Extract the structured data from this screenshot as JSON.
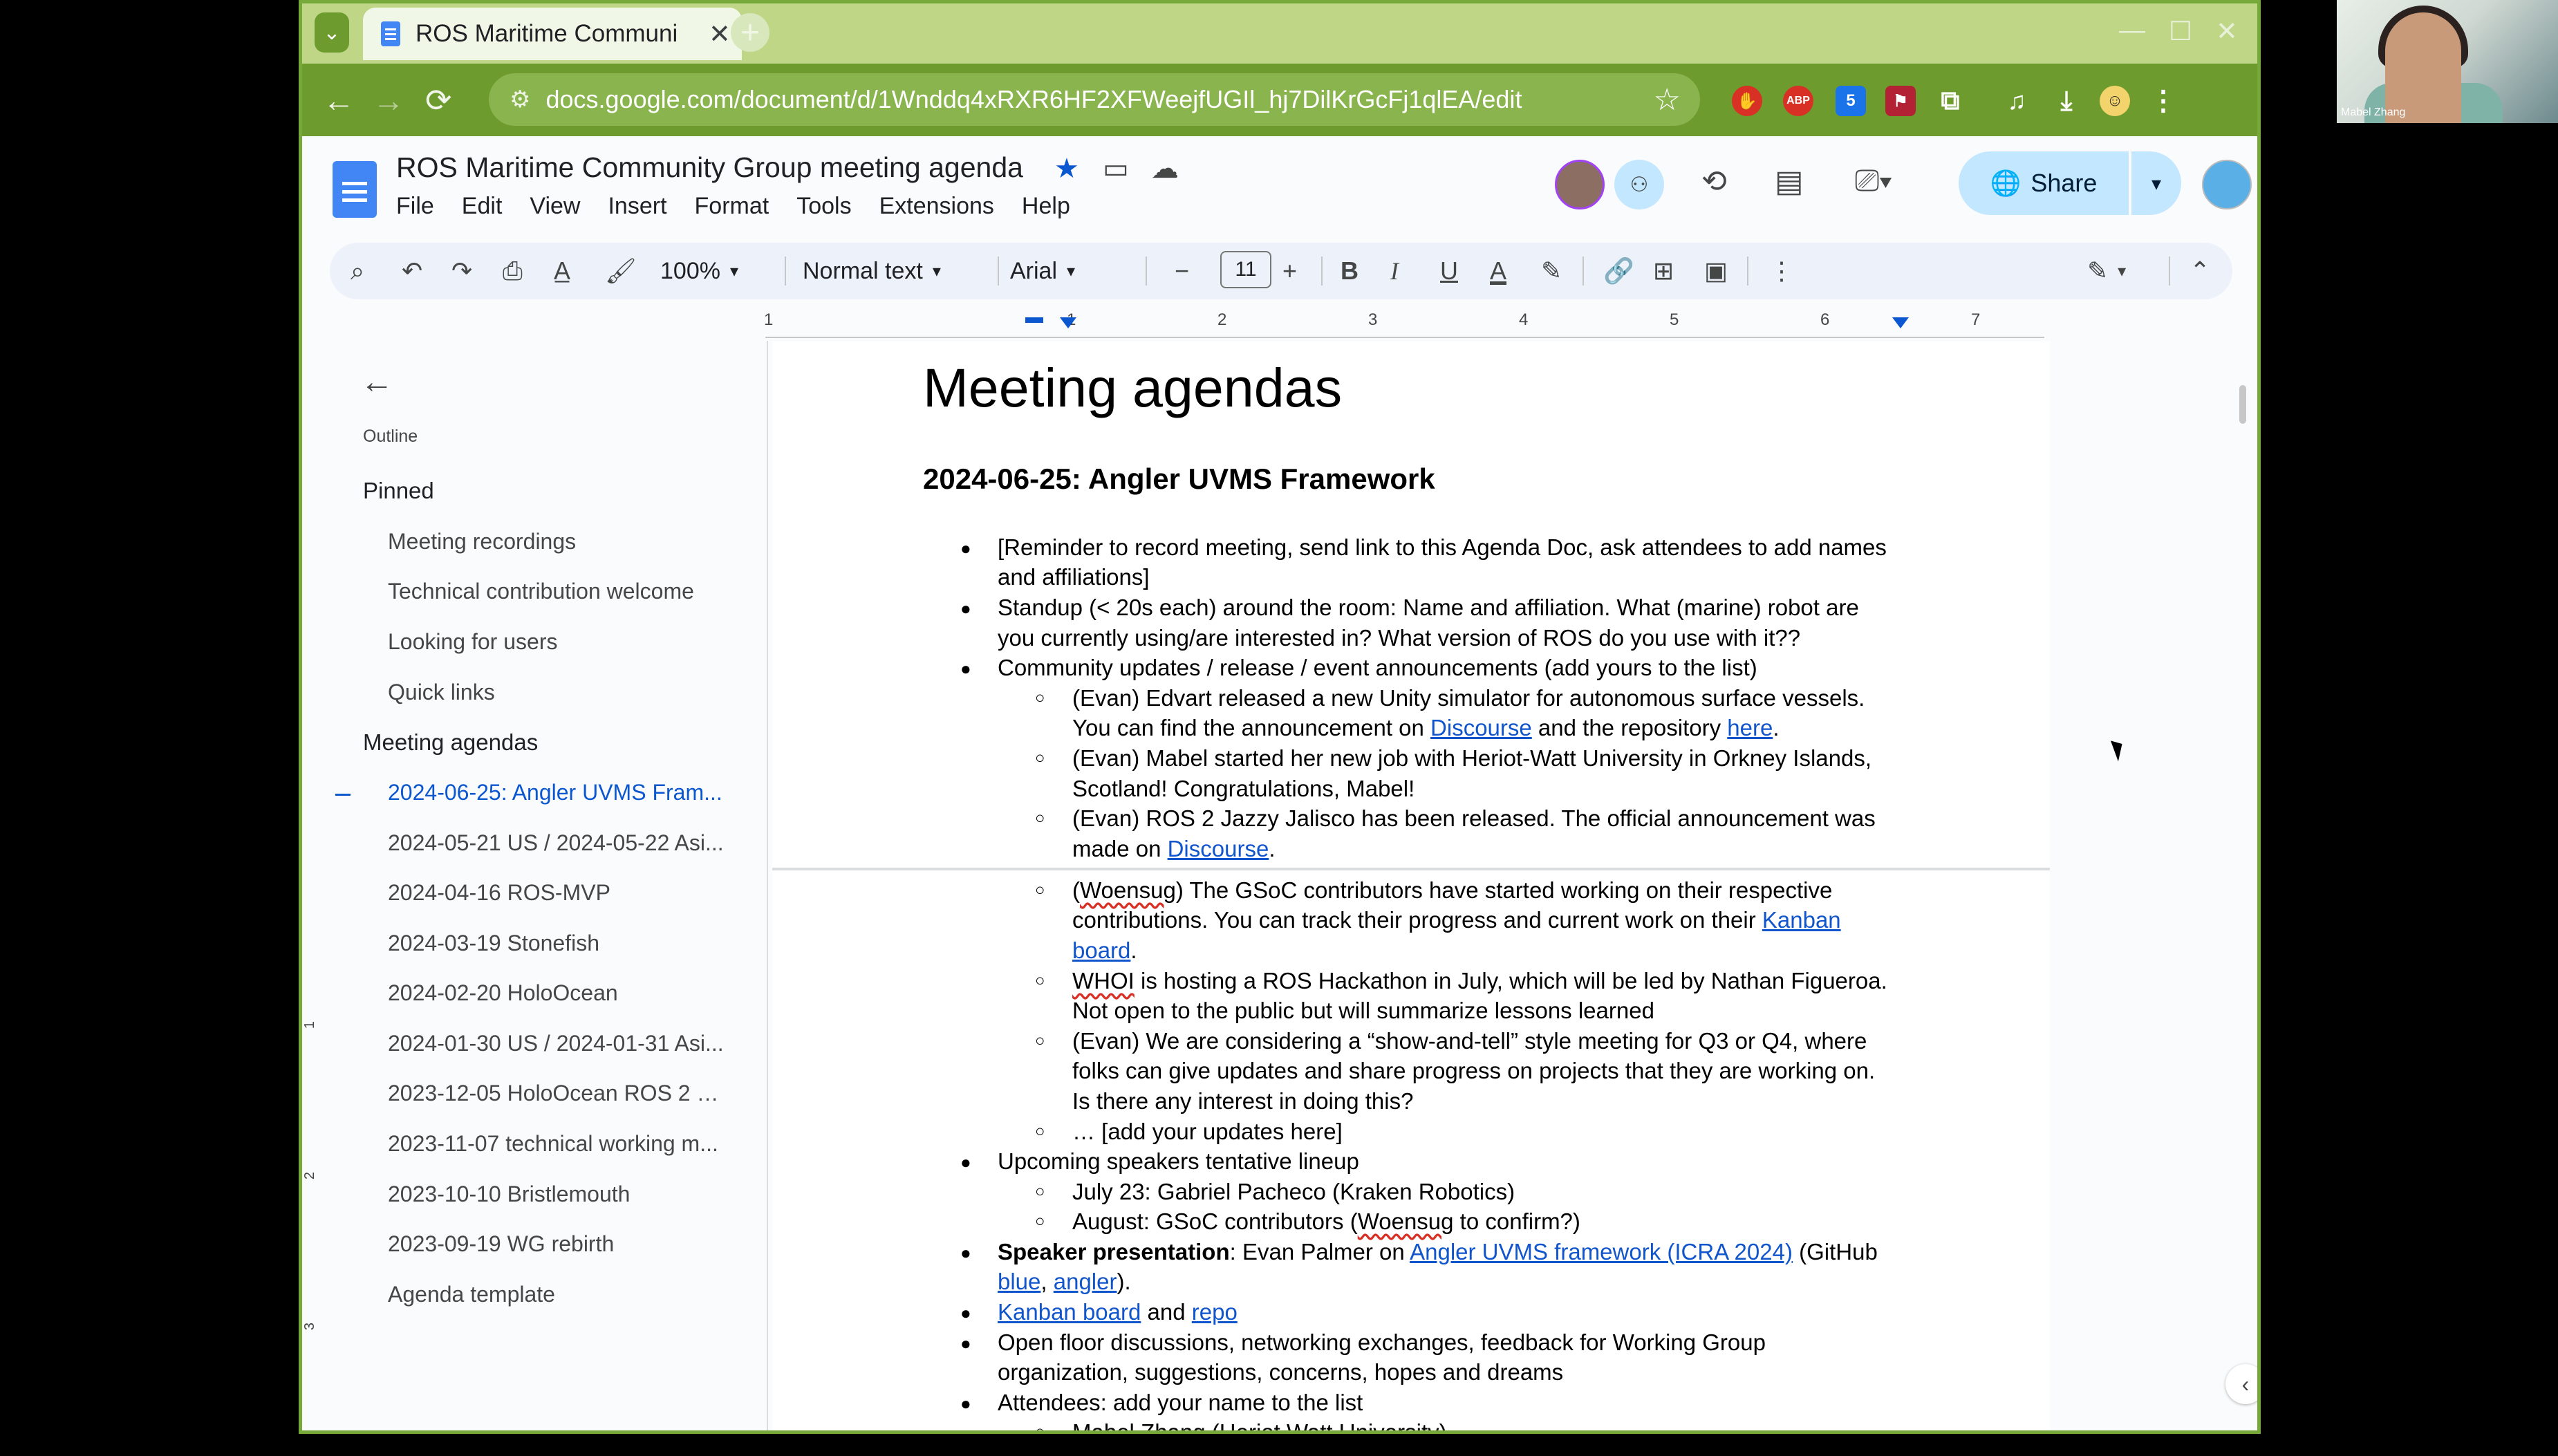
{
  "browser": {
    "tab_title": "ROS Maritime Communi",
    "url": "docs.google.com/document/d/1Wnddq4xRXR6HF2XFWeejfUGIl_hj7DilKrGcFj1qlEA/edit",
    "extension_badge": "5",
    "window_controls": [
      "—",
      "☐",
      "✕"
    ]
  },
  "docs": {
    "title": "ROS Maritime Community Group meeting agenda",
    "menu": [
      "File",
      "Edit",
      "View",
      "Insert",
      "Format",
      "Tools",
      "Extensions",
      "Help"
    ],
    "share_label": "Share",
    "toolbar": {
      "zoom": "100%",
      "style": "Normal text",
      "font": "Arial",
      "font_size": "11"
    },
    "ruler_numbers": [
      "1",
      "1",
      "2",
      "3",
      "4",
      "5",
      "6",
      "7"
    ]
  },
  "outline": {
    "label": "Outline",
    "items": [
      {
        "text": "Pinned",
        "level": 1
      },
      {
        "text": "Meeting recordings",
        "level": 2
      },
      {
        "text": "Technical contribution welcome",
        "level": 2
      },
      {
        "text": "Looking for users",
        "level": 2
      },
      {
        "text": "Quick links",
        "level": 2
      },
      {
        "text": "Meeting agendas",
        "level": 1
      },
      {
        "text": "2024-06-25: Angler UVMS Fram...",
        "level": 2,
        "active": true
      },
      {
        "text": "2024-05-21 US / 2024-05-22 Asi...",
        "level": 2
      },
      {
        "text": "2024-04-16 ROS-MVP",
        "level": 2
      },
      {
        "text": "2024-03-19 Stonefish",
        "level": 2
      },
      {
        "text": "2024-02-20 HoloOcean",
        "level": 2
      },
      {
        "text": "2024-01-30 US / 2024-01-31 Asi...",
        "level": 2
      },
      {
        "text": "2023-12-05 HoloOcean ROS 2 br...",
        "level": 2
      },
      {
        "text": "2023-11-07 technical working m...",
        "level": 2
      },
      {
        "text": "2023-10-10 Bristlemouth",
        "level": 2
      },
      {
        "text": "2023-09-19 WG rebirth",
        "level": 2
      },
      {
        "text": "Agenda template",
        "level": 2
      }
    ]
  },
  "vruler_numbers": [
    "1",
    "2",
    "3"
  ],
  "document": {
    "heading": "Meeting agendas",
    "subheading": "2024-06-25: Angler UVMS Framework",
    "l01": "[Reminder to record meeting, send link to this Agenda Doc, ask attendees to add names",
    "l02": "and affiliations]",
    "l03": "Standup (< 20s each) around the room: Name and affiliation. What (marine) robot are",
    "l04": "you currently using/are interested in? What version of ROS do you use with it??",
    "l05": "Community updates / release / event announcements (add yours to the list)",
    "l06": "(Evan) Edvart released a new Unity simulator for autonomous surface vessels.",
    "l07a": "You can find the announcement on ",
    "l07b": "Discourse",
    "l07c": " and the repository ",
    "l07d": "here",
    "l07e": ".",
    "l08": "(Evan) Mabel started her new job with Heriot-Watt University in Orkney Islands,",
    "l09": "Scotland! Congratulations, Mabel!",
    "l10": "(Evan) ROS 2 Jazzy Jalisco has been released. The official announcement was",
    "l11a": "made on ",
    "l11b": "Discourse",
    "l11c": ".",
    "l12a": "(",
    "l12b": "Woensug",
    "l12c": ") The GSoC contributors have started working on their respective",
    "l13a": "contributions. You can track their progress and current work on their ",
    "l13b": "Kanban",
    "l14a": "board",
    "l14b": ".",
    "l15a": "WHOI",
    "l15b": " is hosting a ROS Hackathon in July, which will be led by Nathan Figueroa.",
    "l16": "Not open to the public but will summarize lessons learned",
    "l17": "(Evan) We are considering a “show-and-tell” style meeting for Q3 or Q4, where",
    "l18": "folks can give updates and share progress on projects that they are working on.",
    "l19": "Is there any interest in doing this?",
    "l20": "… [add your updates here]",
    "l21": "Upcoming speakers tentative lineup",
    "l22": "July 23: Gabriel Pacheco (Kraken Robotics)",
    "l23a": "August: GSoC contributors (",
    "l23b": "Woensug",
    "l23c": " to confirm?)",
    "l24a": "Speaker presentation",
    "l24b": ": Evan Palmer on ",
    "l24c": "Angler UVMS framework (ICRA 2024)",
    "l24d": " (GitHub",
    "l25a": "blue",
    "l25b": ", ",
    "l25c": "angler",
    "l25d": ").",
    "l26a": "Kanban board",
    "l26b": " and ",
    "l26c": "repo",
    "l27": "Open floor discussions, networking exchanges, feedback for Working Group",
    "l28": "organization, suggestions, concerns, hopes and dreams",
    "l29": "Attendees: add your name to the list",
    "l30": "Mabel Zhang (Heriot Watt University)"
  },
  "video": {
    "participant_name": "Mabel Zhang"
  },
  "colors": {
    "browser_frame": "#76a83a",
    "link": "#1155cc",
    "active_outline": "#0b57d0",
    "share_button": "#c2e7ff"
  }
}
